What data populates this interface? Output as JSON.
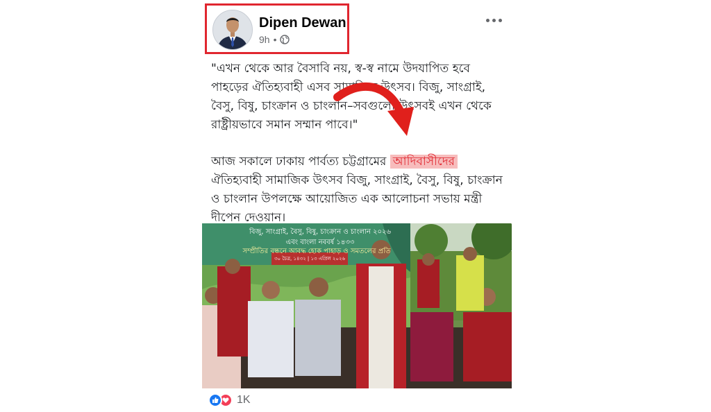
{
  "author": {
    "name": "Dipen Dewan",
    "time": "9h",
    "separator": "•",
    "audience_icon": "globe-icon"
  },
  "more_icon": "more-horizontal-icon",
  "post": {
    "quote": "\"এখন থেকে আর বৈসাবি নয়, স্ব-স্ব নামে উদযাপিত হবে পাহড়ের ঐতিহ্যবাহী এসব সামাজিক উৎসব। বিজু, সাংগ্রাই, বৈসু, বিষু, চাংক্রান ও চাংলান–সবগুলো উৎসবই এখন থেকে রাষ্ট্রীয়ভাবে সমান সম্মান পাবে।\"",
    "para_before": "আজ সকালে ঢাকায় পার্বত্য চট্টগ্রামের ",
    "highlight": "আদিবাসীদের",
    "para_after": " ঐতিহ্যবাহী সামাজিক উৎসব বিজু, সাংগ্রাই, বৈসু, বিষু, চাংক্রান ও চাংলান উপলক্ষে আয়োজিত এক আলোচনা সভায় মন্ত্রী দীপেন দেওয়ান।"
  },
  "banner": {
    "line1": "বিজু, সাংগ্রাই, বৈসু, বিষু, চাংক্রান ও চাংলান ২০২৬",
    "line2": "এবং বাংলা নববর্ষ ১৪৩৩",
    "line3": "সম্প্রীতির বন্ধনে আবদ্ধ হোক পাহাড় ও সমতলের প্রতি",
    "date": "৩০ চৈত্র, ১৪৩২ | ১৩ এপ্রিল ২০২৬"
  },
  "reactions": {
    "icons": [
      "like-icon",
      "love-icon"
    ],
    "count": "1K"
  },
  "colors": {
    "highlight_border": "#e0262f",
    "highlight_bg": "#f7bcbc",
    "like": "#1877f2",
    "love": "#f33e58",
    "meta": "#65676b"
  }
}
